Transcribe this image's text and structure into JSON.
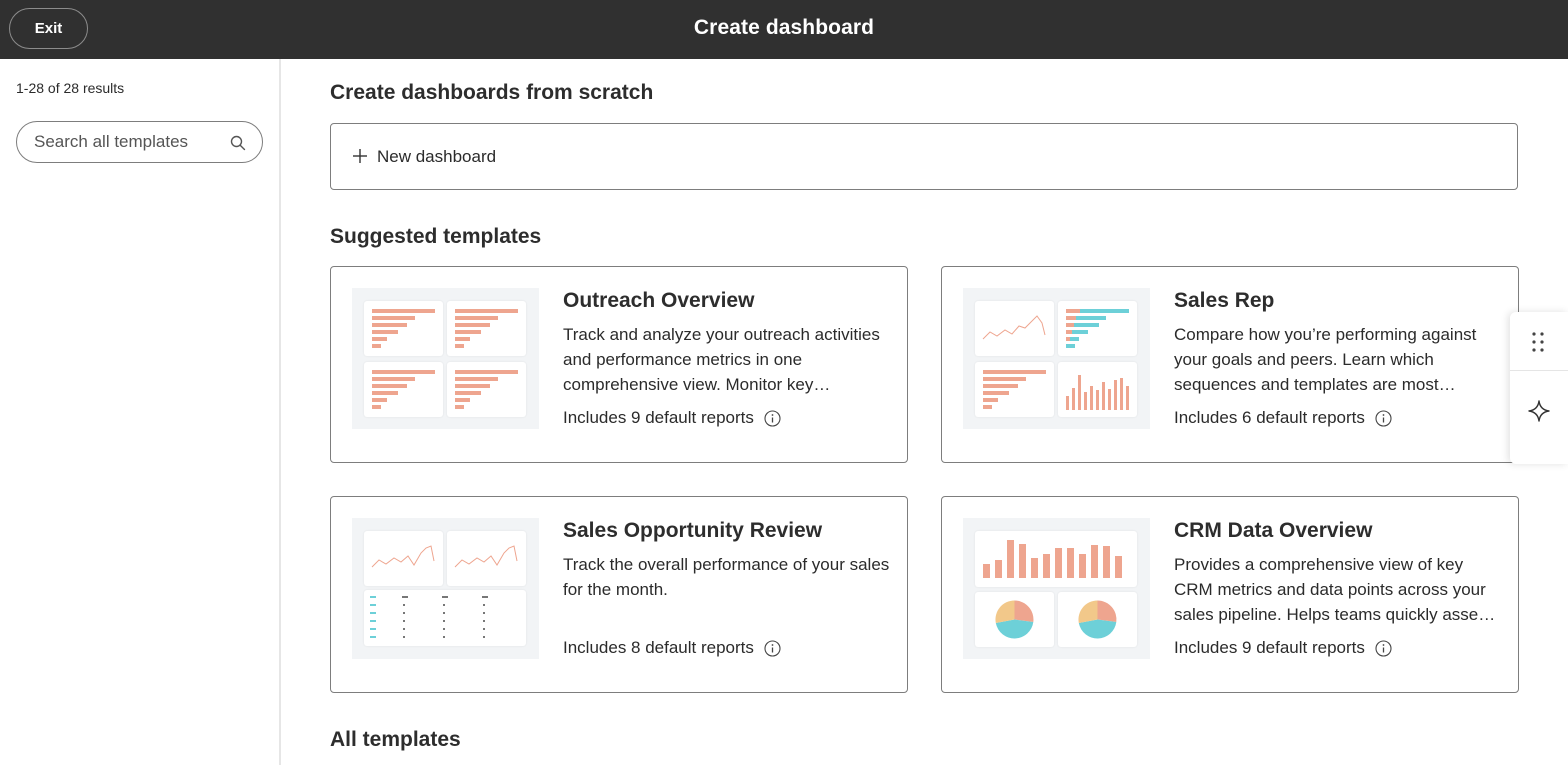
{
  "header": {
    "exit_label": "Exit",
    "title": "Create dashboard"
  },
  "sidebar": {
    "results": "1-28 of 28 results",
    "search_placeholder": "Search all templates"
  },
  "main": {
    "scratch_heading": "Create dashboards from scratch",
    "new_dashboard_label": "New dashboard",
    "suggested_heading": "Suggested templates",
    "all_heading": "All templates",
    "cards": [
      {
        "title": "Outreach Overview",
        "description": "Track and analyze your outreach activities and performance metrics in one comprehensive view. Monitor key…",
        "reports": "Includes 9 default reports"
      },
      {
        "title": "Sales Rep",
        "description": "Compare how you’re performing against your goals and peers. Learn which sequences and templates are most…",
        "reports": "Includes 6 default reports"
      },
      {
        "title": "Sales Opportunity Review",
        "description": "Track the overall performance of your sales for the month.",
        "reports": "Includes 8 default reports"
      },
      {
        "title": "CRM Data Overview",
        "description": "Provides a comprehensive view of key CRM metrics and data points across your sales pipeline. Helps teams quickly asse…",
        "reports": "Includes 9 default reports"
      }
    ]
  },
  "colors": {
    "topbar": "#303030",
    "accent_orange": "#eea58f",
    "accent_teal": "#6dd0d8",
    "accent_yellow": "#f2c88a"
  },
  "icons": [
    "search-icon",
    "plus-icon",
    "info-icon",
    "grip-icon",
    "sparkle-icon"
  ]
}
